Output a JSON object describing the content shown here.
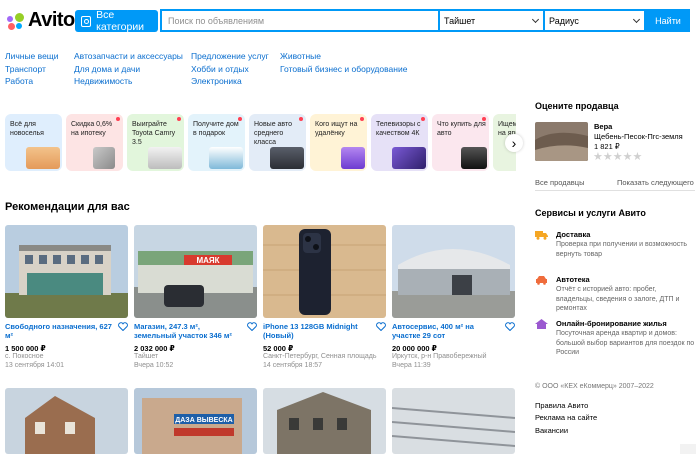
{
  "header": {
    "logo_text": "Avito",
    "categories_button": "Все категории",
    "search_placeholder": "Поиск по объявлениям",
    "city_select": "Тайшет",
    "radius_select": "Радиус",
    "find_button": "Найти"
  },
  "categories": {
    "col1": [
      "Личные вещи",
      "Транспорт",
      "Работа"
    ],
    "col2": [
      "Автозапчасти и аксессуары",
      "Для дома и дачи",
      "Недвижимость"
    ],
    "col3": [
      "Предложение услуг",
      "Хобби и отдых",
      "Электроника"
    ],
    "col4": [
      "Животные",
      "Готовый бизнес и оборудование"
    ]
  },
  "stories": [
    {
      "text": "Всё для новоселья",
      "bg": "#dfeefd"
    },
    {
      "text": "Скидка 0,6% на ипотеку",
      "bg": "#fde4e4"
    },
    {
      "text": "Выиграйте Toyota Camry 3.5",
      "bg": "#e2f6dc"
    },
    {
      "text": "Получите дом в подарок",
      "bg": "#e3f3fb"
    },
    {
      "text": "Новые авто среднего класса",
      "bg": "#e3ecf7"
    },
    {
      "text": "Кого ищут на удалёнку",
      "bg": "#fff3d6"
    },
    {
      "text": "Телевизоры с качеством 4К",
      "bg": "#e6e1f7"
    },
    {
      "text": "Что купить для авто",
      "bg": "#fbe7ee"
    },
    {
      "text": "Ищем мечты на ярм",
      "bg": "#e8f4e0"
    }
  ],
  "recommendations": {
    "title": "Рекомендации для вас",
    "items": [
      {
        "title": "Свободного назначения, 627 м²",
        "price": "1 500 000 ₽",
        "location": "с. Покосное",
        "date": "13 сентября 14:01"
      },
      {
        "title": "Магазин, 247.3 м², земельный участок 346 м²",
        "price": "2 032 000 ₽",
        "location": "Тайшет",
        "date": "Вчера 10:52"
      },
      {
        "title": "iPhone 13 128GB Midnight (Новый)",
        "price": "52 000 ₽",
        "location": "Санкт-Петербург, Сенная площадь",
        "date": "14 сентября 18:57"
      },
      {
        "title": "Автосервис, 400 м² на участке 29 сот",
        "price": "20 000 000 ₽",
        "location": "Иркутск, р-н Правобережный",
        "date": "Вчера 11:39"
      }
    ],
    "second_row_sign": "ДАЗА ВЫВЕСКА"
  },
  "photo_signs": {
    "shop_sign": "МАЯК"
  },
  "sidebar": {
    "rate_title": "Оцените продавца",
    "seller_name": "Вера",
    "seller_item": "Щебень-Песок-Пгс-земля",
    "seller_price": "1 821 ₽",
    "stars": "★★★★★",
    "all_sellers": "Все продавцы",
    "show_next": "Показать следующего",
    "services_title": "Сервисы и услуги Авито",
    "services": [
      {
        "name": "Доставка",
        "desc": "Проверка при получении и возможность вернуть товар",
        "color": "#f5a623"
      },
      {
        "name": "Автотека",
        "desc": "Отчёт с историей авто: пробег, владельцы, сведения о залоге, ДТП и ремонтах",
        "color": "#ef6c3c"
      },
      {
        "name": "Онлайн-бронирование жилья",
        "desc": "Посуточная аренда квартир и домов: большой выбор вариантов для поездок по России",
        "color": "#9b59d0"
      }
    ],
    "copyright": "© ООО «КЕХ еКоммерц» 2007–2022",
    "footer_links": [
      "Правила Авито",
      "Реклама на сайте",
      "Вакансии"
    ]
  },
  "colors": {
    "accent": "#0099f7",
    "link": "#0a6ecf"
  }
}
